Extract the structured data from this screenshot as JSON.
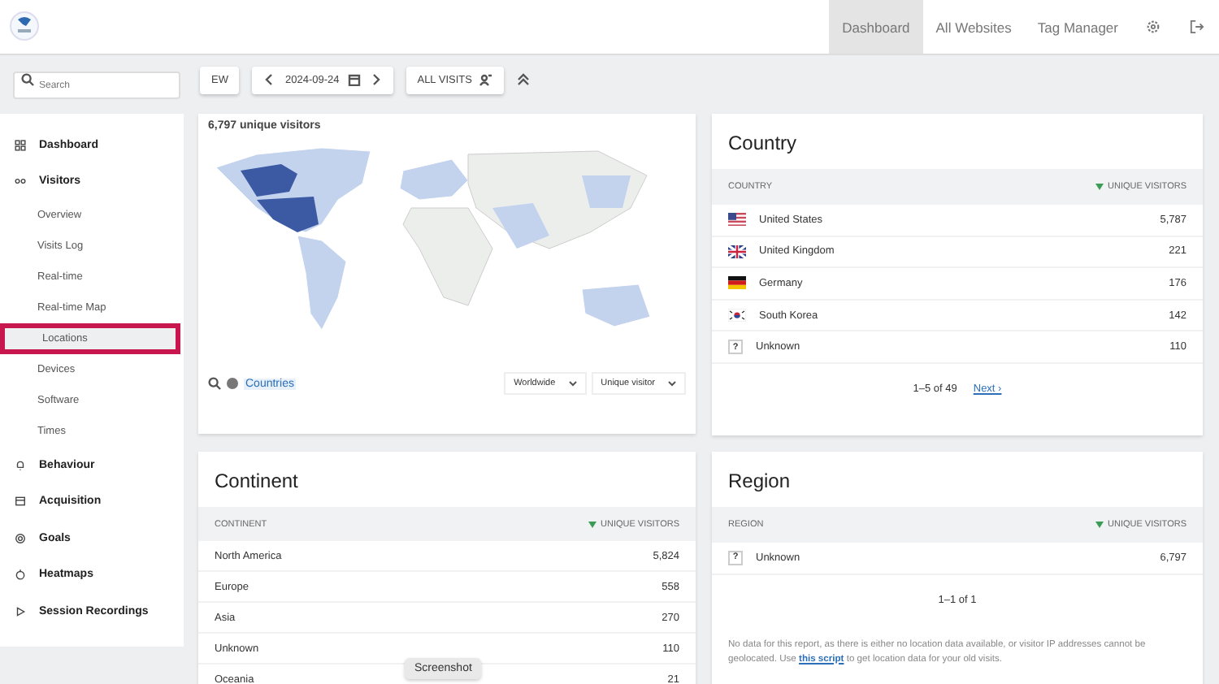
{
  "topnav": [
    {
      "label": "Dashboard",
      "selected": true
    },
    {
      "label": "All Websites",
      "selected": false
    },
    {
      "label": "Tag Manager",
      "selected": false
    }
  ],
  "toolbar": {
    "search": {
      "placeholder": "Search"
    },
    "period": "EW",
    "date": "2024-09-24",
    "segment": "ALL VISITS"
  },
  "sidebar": {
    "items": [
      {
        "label": "Dashboard"
      },
      {
        "label": "Visitors",
        "children": [
          {
            "label": "Overview",
            "selected": false
          },
          {
            "label": "Visits Log",
            "selected": false
          },
          {
            "label": "Real-time",
            "selected": false
          },
          {
            "label": "Real-time Map",
            "selected": false
          },
          {
            "label": "Locations",
            "selected": true
          },
          {
            "label": "Devices",
            "selected": false
          },
          {
            "label": "Software",
            "selected": false
          },
          {
            "label": "Times",
            "selected": false
          }
        ]
      },
      {
        "label": "Behaviour"
      },
      {
        "label": "Acquisition"
      },
      {
        "label": "Goals"
      },
      {
        "label": "Heatmaps"
      },
      {
        "label": "Session Recordings"
      }
    ]
  },
  "map_card": {
    "title": "6,797 unique visitors",
    "link": "Countries",
    "region_select": "Worldwide",
    "metric_select": "Unique visitor"
  },
  "country": {
    "title": "Country",
    "columns": [
      "COUNTRY",
      "UNIQUE VISITORS"
    ],
    "rows": [
      {
        "kind": "us",
        "name": "United States",
        "value": "5,787"
      },
      {
        "kind": "gb",
        "name": "United Kingdom",
        "value": "221"
      },
      {
        "kind": "de",
        "name": "Germany",
        "value": "176"
      },
      {
        "kind": "kr",
        "name": "South Korea",
        "value": "142"
      },
      {
        "kind": "unknown",
        "name": "Unknown",
        "value": "110",
        "mark": "?"
      }
    ],
    "pager": "1–5 of 49",
    "next": "Next ›"
  },
  "continent": {
    "title": "Continent",
    "columns": [
      "CONTINENT",
      "UNIQUE VISITORS"
    ],
    "rows": [
      {
        "name": "North America",
        "value": "5,824"
      },
      {
        "name": "Europe",
        "value": "558"
      },
      {
        "name": "Asia",
        "value": "270"
      },
      {
        "name": "Unknown",
        "value": "110"
      },
      {
        "name": "Oceania",
        "value": "21"
      }
    ]
  },
  "region": {
    "title": "Region",
    "columns": [
      "REGION",
      "UNIQUE VISITORS"
    ],
    "rows": [
      {
        "kind": "unknown",
        "name": "Unknown",
        "value": "6,797",
        "mark": "?"
      }
    ],
    "pager": "1–1 of 1",
    "note_before": "No data for this report, as there is either no location data available, or visitor IP addresses cannot be geolocated. Use ",
    "note_link": "this script",
    "note_after": " to get location data for your old visits."
  },
  "tooltip": "Screenshot"
}
